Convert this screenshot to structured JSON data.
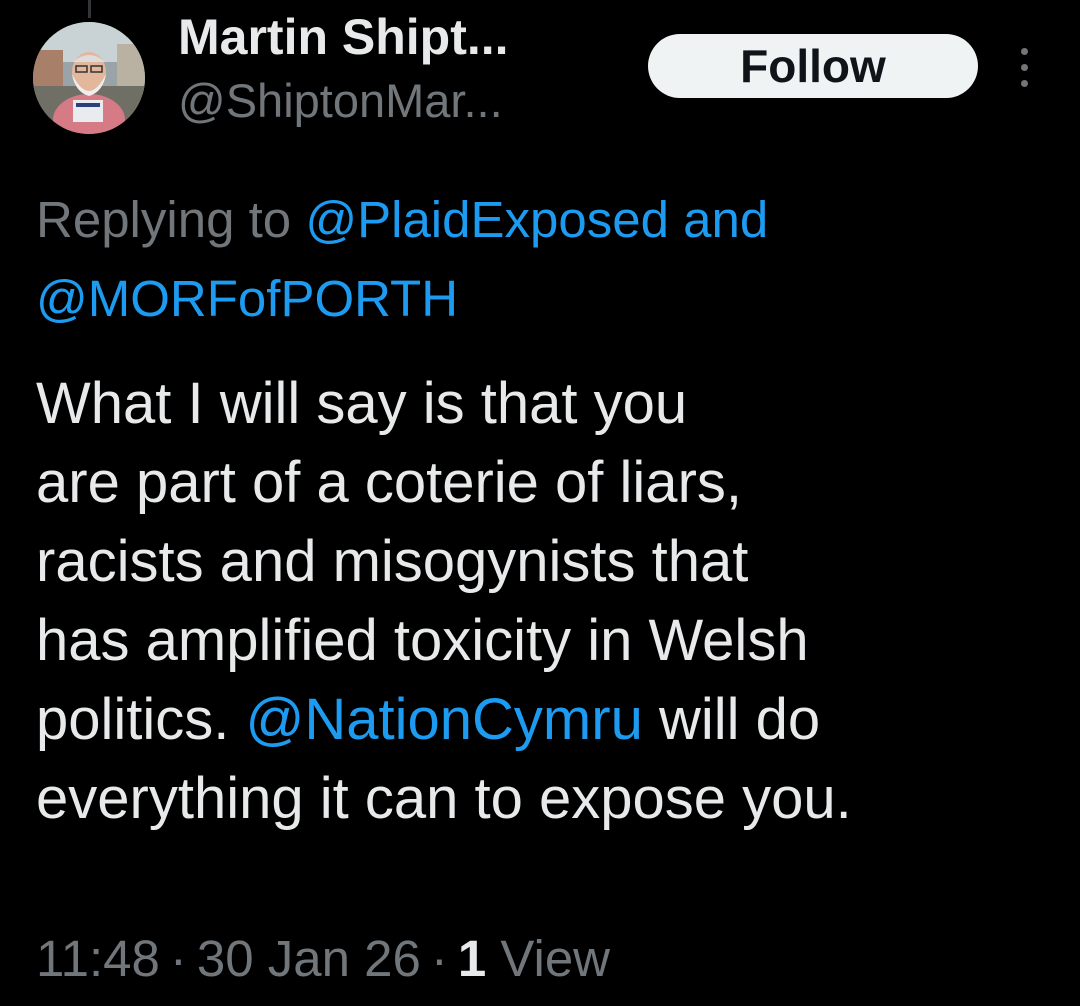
{
  "author": {
    "display_name": "Martin Shipt...",
    "handle": "@ShiptonMar...",
    "avatar_icon": "profile-photo"
  },
  "actions": {
    "follow_label": "Follow",
    "more_icon": "more-vertical-icon"
  },
  "reply": {
    "prefix": "Replying to ",
    "mentions": [
      "@PlaidExposed",
      "@MORFofPORTH"
    ],
    "joiner": " and"
  },
  "tweet": {
    "lines": [
      "What I will say is that you",
      "are part of a coterie of liars,",
      "racists and misogynists that",
      "has amplified toxicity in Welsh"
    ],
    "line5_before": "politics. ",
    "line5_mention": "@NationCymru",
    "line5_after": " will do",
    "line6": "everything it can to expose you."
  },
  "meta": {
    "time": "11:48",
    "date": "30 Jan 26",
    "separator": "·",
    "views_count": "1",
    "views_label": "View"
  },
  "colors": {
    "background": "#000000",
    "text": "#e7e9ea",
    "secondary": "#71767b",
    "link": "#1d9bf0",
    "follow_bg": "#eff3f4"
  }
}
